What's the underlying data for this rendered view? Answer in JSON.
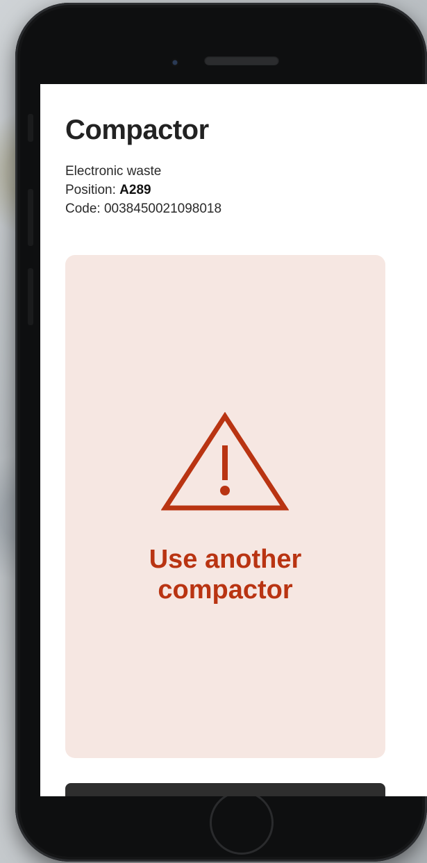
{
  "screen": {
    "title": "Compactor",
    "waste_type": "Electronic waste",
    "position_label": "Position: ",
    "position_value": "A289",
    "code_label": "Code: ",
    "code_value": "0038450021098018"
  },
  "alert": {
    "icon": "warning-triangle-icon",
    "line1": "Use another",
    "line2": "compactor",
    "color": "#b93412",
    "background": "#f6e7e2"
  },
  "action_button": {
    "label": ""
  }
}
